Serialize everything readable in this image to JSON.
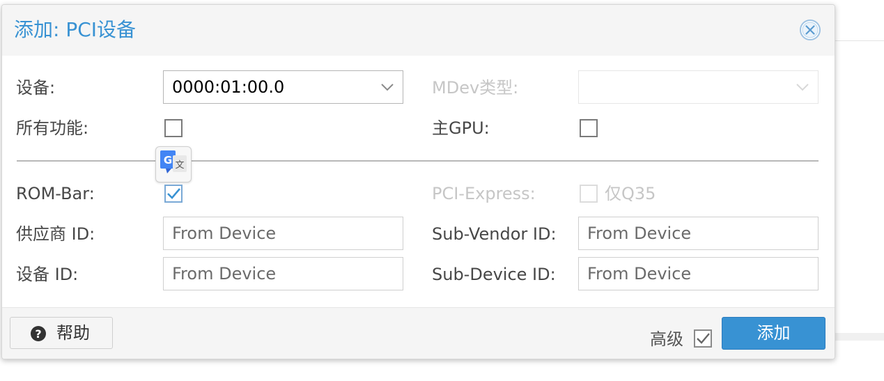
{
  "dialog": {
    "title": "添加: PCI设备"
  },
  "form": {
    "device": {
      "label": "设备:",
      "value": "0000:01:00.0"
    },
    "mdev_type": {
      "label": "MDev类型:",
      "value": ""
    },
    "all_functions": {
      "label": "所有功能:",
      "checked": false
    },
    "primary_gpu": {
      "label": "主GPU:",
      "checked": false
    },
    "rom_bar": {
      "label": "ROM-Bar:",
      "checked": true
    },
    "pci_express": {
      "label": "PCI-Express:",
      "checked": false,
      "note": "仅Q35"
    },
    "vendor_id": {
      "label": "供应商 ID:",
      "placeholder": "From Device"
    },
    "sub_vendor_id": {
      "label": "Sub-Vendor ID:",
      "placeholder": "From Device"
    },
    "device_id": {
      "label": "设备 ID:",
      "placeholder": "From Device"
    },
    "sub_device_id": {
      "label": "Sub-Device ID:",
      "placeholder": "From Device"
    }
  },
  "footer": {
    "help_label": "帮助",
    "advanced_label": "高级",
    "advanced_checked": true,
    "add_label": "添加"
  },
  "colors": {
    "accent": "#3892d3",
    "label": "#474747",
    "disabled": "#c6c6c6",
    "icons": [
      "close-icon",
      "chevron-down-icon",
      "help-icon",
      "translate-icon",
      "checkmark-icon"
    ]
  }
}
